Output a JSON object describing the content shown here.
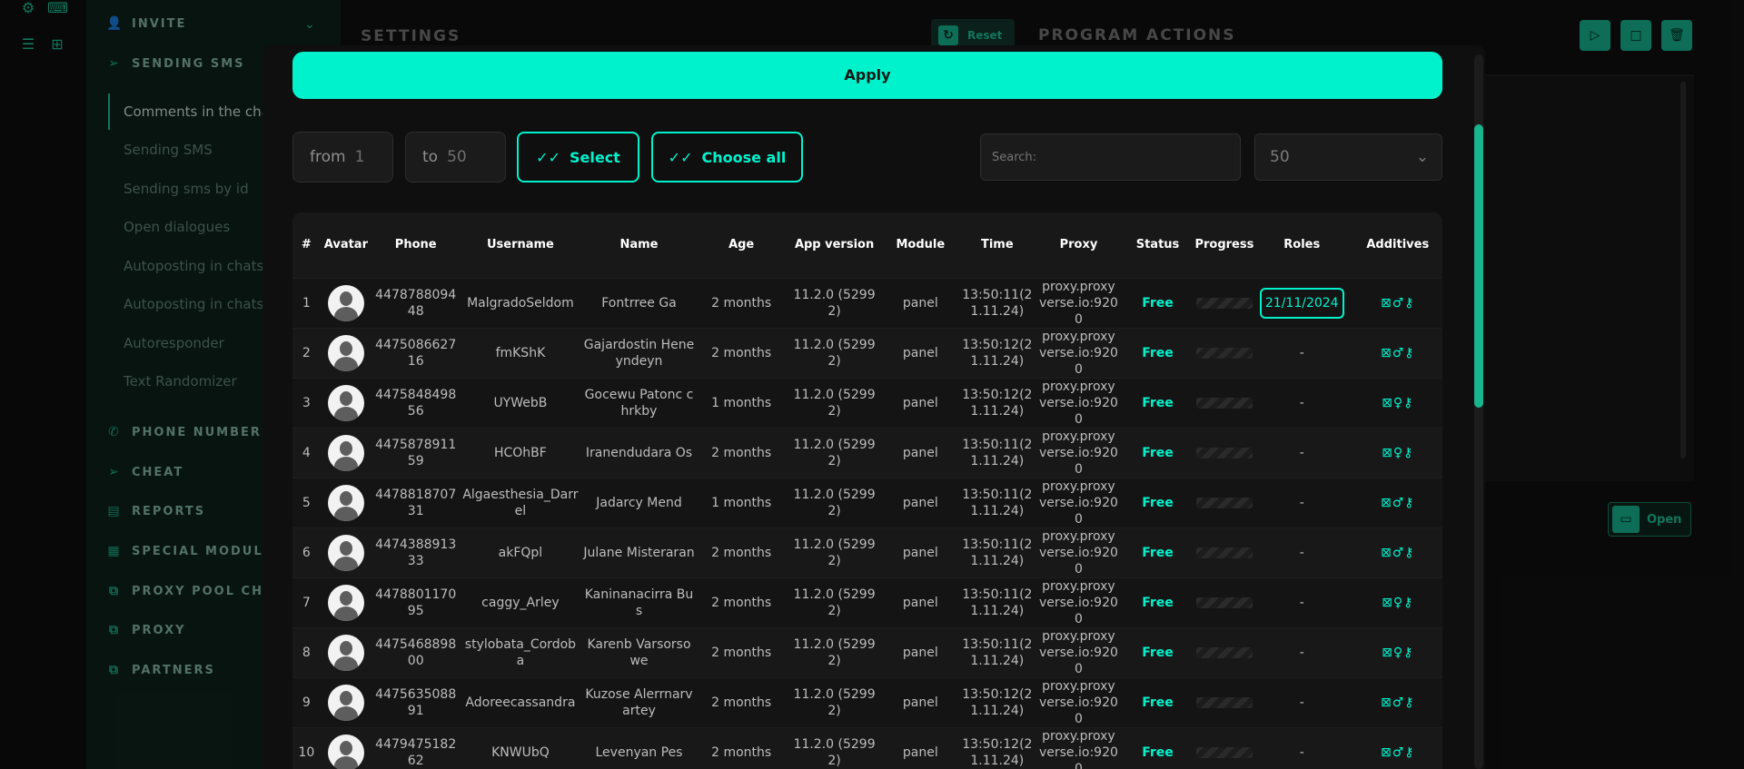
{
  "rail": {
    "icons": [
      "gear-icon",
      "code-icon",
      "document-list-icon",
      "grid-icon"
    ]
  },
  "sidebar": {
    "sections": [
      {
        "label": "INVITE",
        "icon": "user-plus-icon"
      },
      {
        "label": "SENDING SMS",
        "icon": "paper-plane-icon"
      },
      {
        "label": "PHONE NUMBERS",
        "icon": "phone-icon"
      },
      {
        "label": "CHEAT",
        "icon": "paper-plane-icon"
      },
      {
        "label": "REPORTS",
        "icon": "report-icon"
      },
      {
        "label": "SPECIAL MODULES",
        "icon": "module-icon"
      },
      {
        "label": "PROXY POOL CHECK",
        "icon": "network-icon"
      },
      {
        "label": "PROXY",
        "icon": "network-icon"
      },
      {
        "label": "PARTNERS",
        "icon": "network-icon"
      }
    ],
    "sms_items": [
      "Comments in the cha",
      "Sending SMS",
      "Sending sms by id",
      "Open dialogues",
      "Autoposting in chats",
      "Autoposting in chats",
      "Autoresponder",
      "Text Randomizer"
    ]
  },
  "main": {
    "settings_title": "SETTINGS",
    "reset_label": "Reset",
    "program_actions_title": "PROGRAM ACTIONS",
    "open_label": "Open"
  },
  "modal": {
    "apply_label": "Apply",
    "from_label": "from",
    "from_value": "1",
    "to_label": "to",
    "to_value": "50",
    "select_label": "Select",
    "choose_all_label": "Choose all",
    "search_placeholder": "Search:",
    "page_size": "50",
    "headers": [
      "#",
      "Avatar",
      "Phone",
      "Username",
      "Name",
      "Age",
      "App version",
      "Module",
      "Time",
      "Proxy",
      "Status",
      "Progress",
      "Roles",
      "Additives"
    ],
    "rows": [
      {
        "n": "1",
        "phone": "447878809448",
        "username": "MalgradoSeldom",
        "name": "Fontrree Ga",
        "age": "2 months",
        "app": "11.2.0 (52992)",
        "module": "panel",
        "time": "13:50:11(21.11.24)",
        "proxy": "proxy.proxyverse.io:9200",
        "status": "Free",
        "roles": "21/11/2024",
        "additives": "⊠♂⚷"
      },
      {
        "n": "2",
        "phone": "447508662716",
        "username": "fmKShK",
        "name": "Gajardostin Heneyndeyn",
        "age": "2 months",
        "app": "11.2.0 (52992)",
        "module": "panel",
        "time": "13:50:12(21.11.24)",
        "proxy": "proxy.proxyverse.io:9200",
        "status": "Free",
        "roles": "-",
        "additives": "⊠♂⚷"
      },
      {
        "n": "3",
        "phone": "447584849856",
        "username": "UYWebB",
        "name": "Gocewu Patonc chrkby",
        "age": "1 months",
        "app": "11.2.0 (52992)",
        "module": "panel",
        "time": "13:50:12(21.11.24)",
        "proxy": "proxy.proxyverse.io:9200",
        "status": "Free",
        "roles": "-",
        "additives": "⊠♀⚷"
      },
      {
        "n": "4",
        "phone": "447587891159",
        "username": "HCOhBF",
        "name": "Iranendudara Os",
        "age": "2 months",
        "app": "11.2.0 (52992)",
        "module": "panel",
        "time": "13:50:11(21.11.24)",
        "proxy": "proxy.proxyverse.io:9200",
        "status": "Free",
        "roles": "-",
        "additives": "⊠♀⚷"
      },
      {
        "n": "5",
        "phone": "447881870731",
        "username": "Algaesthesia_Darrel",
        "name": "Jadarcy Mend",
        "age": "1 months",
        "app": "11.2.0 (52992)",
        "module": "panel",
        "time": "13:50:11(21.11.24)",
        "proxy": "proxy.proxyverse.io:9200",
        "status": "Free",
        "roles": "-",
        "additives": "⊠♂⚷"
      },
      {
        "n": "6",
        "phone": "447438891333",
        "username": "akFQpl",
        "name": "Julane Misteraran",
        "age": "2 months",
        "app": "11.2.0 (52992)",
        "module": "panel",
        "time": "13:50:11(21.11.24)",
        "proxy": "proxy.proxyverse.io:9200",
        "status": "Free",
        "roles": "-",
        "additives": "⊠♂⚷"
      },
      {
        "n": "7",
        "phone": "447880117095",
        "username": "caggy_Arley",
        "name": "Kaninanacirra Bus",
        "age": "2 months",
        "app": "11.2.0 (52992)",
        "module": "panel",
        "time": "13:50:11(21.11.24)",
        "proxy": "proxy.proxyverse.io:9200",
        "status": "Free",
        "roles": "-",
        "additives": "⊠♀⚷"
      },
      {
        "n": "8",
        "phone": "447546889800",
        "username": "stylobata_Cordoba",
        "name": "Karenb Varsorsowe",
        "age": "2 months",
        "app": "11.2.0 (52992)",
        "module": "panel",
        "time": "13:50:11(21.11.24)",
        "proxy": "proxy.proxyverse.io:9200",
        "status": "Free",
        "roles": "-",
        "additives": "⊠♀⚷"
      },
      {
        "n": "9",
        "phone": "447563508891",
        "username": "Adoreecassandra",
        "name": "Kuzose Alerrnarvartey",
        "age": "2 months",
        "app": "11.2.0 (52992)",
        "module": "panel",
        "time": "13:50:12(21.11.24)",
        "proxy": "proxy.proxyverse.io:9200",
        "status": "Free",
        "roles": "-",
        "additives": "⊠♂⚷"
      },
      {
        "n": "10",
        "phone": "447947518262",
        "username": "KNWUbQ",
        "name": "Levenyan Pes",
        "age": "2 months",
        "app": "11.2.0 (52992)",
        "module": "panel",
        "time": "13:50:12(21.11.24)",
        "proxy": "proxy.proxyverse.io:9200",
        "status": "Free",
        "roles": "-",
        "additives": "⊠♂⚷"
      }
    ]
  },
  "colors": {
    "accent": "#00f2cd",
    "accent_dark": "#19b58c",
    "sidebar_bg": "#0d2019",
    "modal_bg": "#0f0f0f"
  }
}
